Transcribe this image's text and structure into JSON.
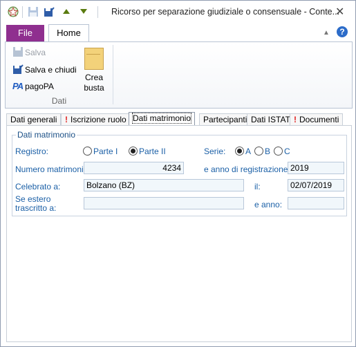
{
  "window": {
    "title": "Ricorso per separazione giudiziale o consensuale - Conte...",
    "close_glyph": "✕"
  },
  "ribbon": {
    "tabs": {
      "file": "File",
      "home": "Home"
    },
    "buttons": {
      "salva": "Salva",
      "salva_e_chiudi": "Salva e chiudi",
      "pagopa": "pagoPA",
      "crea_busta_line1": "Crea",
      "crea_busta_line2": "busta"
    },
    "group_label": "Dati",
    "help_glyph": "?"
  },
  "form_tabs": [
    {
      "label": "Dati generali",
      "warning": false
    },
    {
      "label": "Iscrizione ruolo",
      "warning": true
    },
    {
      "label": "Dati matrimonio",
      "warning": false,
      "active": true
    },
    {
      "label": "Partecipanti",
      "warning": false
    },
    {
      "label": "Dati ISTAT",
      "warning": false
    },
    {
      "label": "Documenti",
      "warning": true
    }
  ],
  "section": {
    "title": "Dati matrimonio",
    "registro": {
      "label": "Registro:",
      "options": [
        "Parte I",
        "Parte II"
      ],
      "selected": "Parte II"
    },
    "serie": {
      "label": "Serie:",
      "options": [
        "A",
        "B",
        "C"
      ],
      "selected": "A"
    },
    "numero_matrimonio": {
      "label": "Numero matrimonio:",
      "value": "4234"
    },
    "anno_registrazione": {
      "label": "e anno di registrazione:",
      "value": "2019"
    },
    "celebrato_a": {
      "label": "Celebrato a:",
      "value": "Bolzano (BZ)"
    },
    "il": {
      "label": "il:",
      "value": "02/07/2019"
    },
    "se_estero": {
      "label_line1": "Se estero",
      "label_line2": "trascritto a:",
      "value": ""
    },
    "e_anno": {
      "label": "e anno:",
      "value": ""
    }
  },
  "icons": {
    "warning": "!",
    "colors": {
      "file_tab": "#8f2f8f",
      "label_blue": "#1a5fa6",
      "warning": "#e01f1f"
    }
  }
}
